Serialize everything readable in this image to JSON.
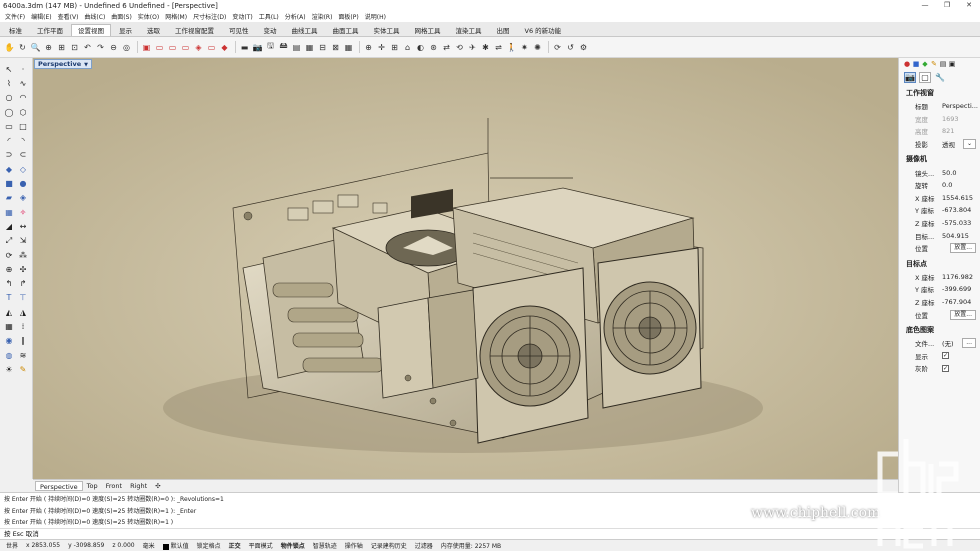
{
  "window": {
    "title": "6400a.3dm (147 MB) - Undefined 6 Undefined - [Perspective]",
    "controls": [
      "—",
      "❐",
      "✕"
    ]
  },
  "menu": [
    "文件(F)",
    "编辑(E)",
    "查看(V)",
    "曲线(C)",
    "曲面(S)",
    "实体(O)",
    "网格(M)",
    "尺寸标注(D)",
    "变动(T)",
    "工具(L)",
    "分析(A)",
    "渲染(R)",
    "面板(P)",
    "说明(H)"
  ],
  "tabs": [
    "标准",
    "工作平面",
    "设置视图",
    "显示",
    "选取",
    "工作视窗配置",
    "可见性",
    "变动",
    "曲线工具",
    "曲面工具",
    "实体工具",
    "网格工具",
    "渲染工具",
    "出图",
    "V6 的新功能"
  ],
  "active_tab": "设置视图",
  "viewport": {
    "label": "Perspective",
    "background": "#cfc5a8"
  },
  "view_tabs": [
    "Perspective",
    "Top",
    "Front",
    "Right",
    "✣"
  ],
  "panel": {
    "section_view": "工作视窗",
    "title_label": "标题",
    "title_value": "Perspecti...",
    "width_label": "宽度",
    "width_value": "1693",
    "height_label": "高度",
    "height_value": "821",
    "projection_label": "投影",
    "projection_value": "透视",
    "section_camera": "摄像机",
    "lens_label": "镜头...",
    "lens_value": "50.0",
    "rotate_label": "旋转",
    "rotate_value": "0.0",
    "cx_label": "X 座标",
    "cx_value": "1554.615",
    "cy_label": "Y 座标",
    "cy_value": "-673.804",
    "cz_label": "Z 座标",
    "cz_value": "-575.033",
    "dist_label": "目标...",
    "dist_value": "504.915",
    "pos_label": "位置",
    "place_button": "放置...",
    "section_target": "目标点",
    "tx_label": "X 座标",
    "tx_value": "1176.982",
    "ty_label": "Y 座标",
    "ty_value": "-399.699",
    "tz_label": "Z 座标",
    "tz_value": "-767.904",
    "tpos_label": "位置",
    "tplace_button": "放置...",
    "section_bg": "底色图案",
    "file_label": "文件...",
    "file_value": "(无)",
    "file_button": "...",
    "show_label": "显示",
    "gray_label": "灰阶"
  },
  "command_history": [
    "按 Enter 开始 ( 持续时间(D)=0  速度(S)=25  转动圈数(R)=0 ): _Revolutions=1",
    "按 Enter 开始 ( 持续时间(D)=0  速度(S)=25  转动圈数(R)=1 ): _Enter",
    "按 Enter 开始 ( 持续时间(D)=0  速度(S)=25  转动圈数(R)=1 )"
  ],
  "command_prompt": "按 Esc 取消",
  "status": {
    "cplane": "世界",
    "x": "x 2853.055",
    "y": "y -3098.859",
    "z": "z 0.000",
    "units": "毫米",
    "layer": "默认值",
    "toggles": [
      "锁定格点",
      "正交",
      "平面模式",
      "物件锁点",
      "智慧轨迹",
      "操作轴",
      "记录建构历史",
      "过滤器"
    ],
    "memory": "内存使用量: 2257 MB"
  },
  "watermark": {
    "url": "www.chiphell.com"
  }
}
